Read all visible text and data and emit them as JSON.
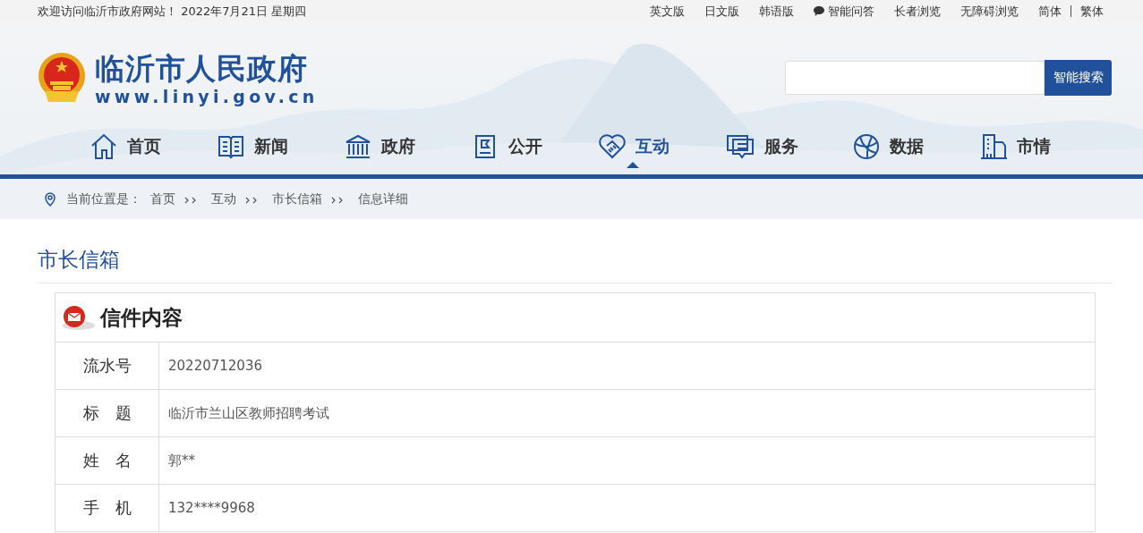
{
  "top_bar": {
    "welcome": "欢迎访问临沂市政府网站！ 2022年7月21日  星期四",
    "links": [
      {
        "kind": "link",
        "label": "英文版"
      },
      {
        "kind": "link",
        "label": "日文版"
      },
      {
        "kind": "link",
        "label": "韩语版"
      },
      {
        "kind": "chat",
        "label": "智能问答"
      },
      {
        "kind": "link",
        "label": "长者浏览"
      },
      {
        "kind": "link",
        "label": "无障碍浏览"
      }
    ],
    "scripts": [
      "简体",
      "繁体"
    ]
  },
  "header": {
    "site_name": "临沂市人民政府",
    "domain": "www.linyi.gov.cn",
    "search": {
      "button": "智能搜索"
    }
  },
  "nav": [
    {
      "label": "首页",
      "selected": false
    },
    {
      "label": "新闻",
      "selected": false
    },
    {
      "label": "政府",
      "selected": false
    },
    {
      "label": "公开",
      "selected": false
    },
    {
      "label": "互动",
      "selected": true
    },
    {
      "label": "服务",
      "selected": false
    },
    {
      "label": "数据",
      "selected": false
    },
    {
      "label": "市情",
      "selected": false
    }
  ],
  "breadcrumb": {
    "prefix": "当前位置是：",
    "items": [
      "首页",
      "互动",
      "市长信箱",
      "信息详细"
    ]
  },
  "section_title": "市长信箱",
  "letter": {
    "title": "信件内容",
    "rows": [
      {
        "label": "流水号",
        "value": "20220712036"
      },
      {
        "label": "标　题",
        "value": "临沂市兰山区教师招聘考试"
      },
      {
        "label": "姓　名",
        "value": "郭**"
      },
      {
        "label": "手　机",
        "value": "132****9968"
      }
    ]
  }
}
